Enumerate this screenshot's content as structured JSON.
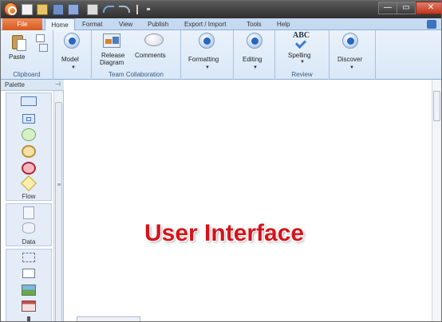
{
  "tabs": {
    "file": "File",
    "home": "Home",
    "format": "Format",
    "view": "View",
    "publish": "Publish",
    "export_import": "Export / Import",
    "tools": "Tools",
    "help": "Help"
  },
  "ribbon": {
    "clipboard": {
      "paste": "Paste",
      "group": "Clipboard"
    },
    "model": {
      "label": "Model"
    },
    "team": {
      "release": "Release",
      "diagram": "Diagram",
      "comments": "Comments",
      "group": "Team Collaboration"
    },
    "formatting": {
      "label": "Formatting"
    },
    "editing": {
      "label": "Editing"
    },
    "review": {
      "spelling": "Spelling",
      "group": "Review",
      "abc": "ABC"
    },
    "discover": {
      "label": "Discover"
    }
  },
  "palette": {
    "title": "Palette",
    "pin": "⊣",
    "sections": {
      "flow": "Flow",
      "data": "Data"
    }
  },
  "canvas": {
    "overlay": "User Interface"
  },
  "colors": {
    "overlay": "#d6131a",
    "accent": "#2b65c2",
    "file_tab": "#e06a2f"
  }
}
